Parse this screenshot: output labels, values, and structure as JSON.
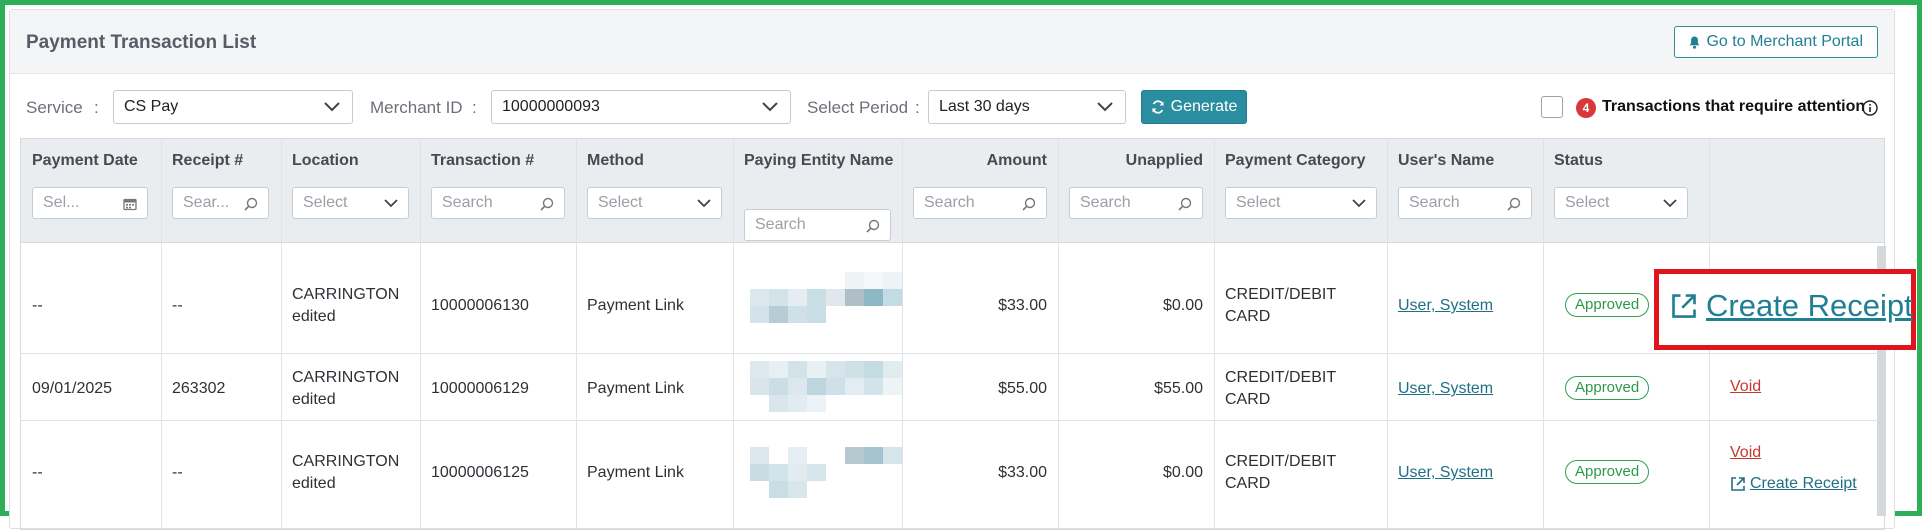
{
  "panel": {
    "title": "Payment Transaction List",
    "portal_button": "Go to Merchant Portal"
  },
  "filters": {
    "service_label": "Service",
    "service_value": "CS Pay",
    "merchant_label": "Merchant ID",
    "merchant_value": "10000000093",
    "period_label": "Select Period",
    "period_value": "Last 30 days",
    "separator": ":",
    "generate_label": "Generate",
    "attention_count": "4",
    "attention_text": "Transactions that require attention"
  },
  "columns": [
    {
      "key": "payment_date",
      "label": "Payment Date",
      "placeholder": "Sel..."
    },
    {
      "key": "receipt",
      "label": "Receipt #",
      "placeholder": "Sear..."
    },
    {
      "key": "location",
      "label": "Location",
      "placeholder": "Select"
    },
    {
      "key": "transaction",
      "label": "Transaction #",
      "placeholder": "Search"
    },
    {
      "key": "method",
      "label": "Method",
      "placeholder": "Select"
    },
    {
      "key": "paying_entity",
      "label": "Paying Entity Name",
      "placeholder": "Search"
    },
    {
      "key": "amount",
      "label": "Amount",
      "placeholder": "Search"
    },
    {
      "key": "unapplied",
      "label": "Unapplied",
      "placeholder": "Search"
    },
    {
      "key": "category",
      "label": "Payment Category",
      "placeholder": "Select"
    },
    {
      "key": "users_name",
      "label": "User's Name",
      "placeholder": "Search"
    },
    {
      "key": "status",
      "label": "Status",
      "placeholder": "Select"
    }
  ],
  "rows": [
    {
      "payment_date": "--",
      "receipt": "--",
      "location_l1": "CARRINGTON",
      "location_l2": "edited",
      "transaction": "10000006130",
      "method": "Payment Link",
      "amount": "$33.00",
      "unapplied": "$0.00",
      "category_l1": "CREDIT/DEBIT",
      "category_l2": "CARD",
      "users_name": "User, System",
      "status": "Approved",
      "action_receipt": "Create Receipt"
    },
    {
      "payment_date": "09/01/2025",
      "receipt": "263302",
      "location_l1": "CARRINGTON",
      "location_l2": "edited",
      "transaction": "10000006129",
      "method": "Payment Link",
      "amount": "$55.00",
      "unapplied": "$55.00",
      "category_l1": "CREDIT/DEBIT",
      "category_l2": "CARD",
      "users_name": "User, System",
      "status": "Approved",
      "action_void": "Void"
    },
    {
      "payment_date": "--",
      "receipt": "--",
      "location_l1": "CARRINGTON",
      "location_l2": "edited",
      "transaction": "10000006125",
      "method": "Payment Link",
      "amount": "$33.00",
      "unapplied": "$0.00",
      "category_l1": "CREDIT/DEBIT",
      "category_l2": "CARD",
      "users_name": "User, System",
      "status": "Approved",
      "action_void": "Void",
      "action_receipt": "Create Receipt"
    }
  ],
  "colors": {
    "accent": "#2b8da0",
    "approved": "#2a9a48",
    "void": "#c5392f",
    "badge": "#d9383a",
    "highlight": "#e0141d",
    "frame": "#2fae5a"
  },
  "icons": [
    "bell-icon",
    "chevron-down-icon",
    "refresh-icon",
    "info-icon",
    "calendar-icon",
    "search-icon",
    "external-link-icon"
  ]
}
